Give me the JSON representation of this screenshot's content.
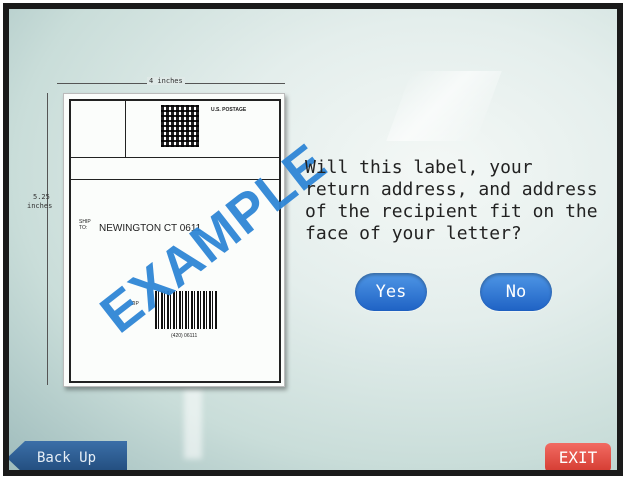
{
  "prompt": {
    "question": "Will this label, your return address, and address of the recipient fit on the face of your letter?"
  },
  "buttons": {
    "yes": "Yes",
    "no": "No",
    "back": "Back Up",
    "exit": "EXIT"
  },
  "example_label": {
    "width_text": "4 inches",
    "height_value": "5.25",
    "height_unit": "inches",
    "postage": "U.S. POSTAGE",
    "ship_to": "SHIP\nTO:",
    "recipient": "NEWINGTON CT 0611",
    "zip_prefix": "ZIP",
    "tracking": "(420) 06111",
    "stamp_text": "EXAMPLE",
    "stamp_color": "#2f86d6"
  },
  "colors": {
    "button_blue": "#2f7fd6",
    "exit_red": "#d9463c",
    "back_blue": "#2a5d92"
  }
}
